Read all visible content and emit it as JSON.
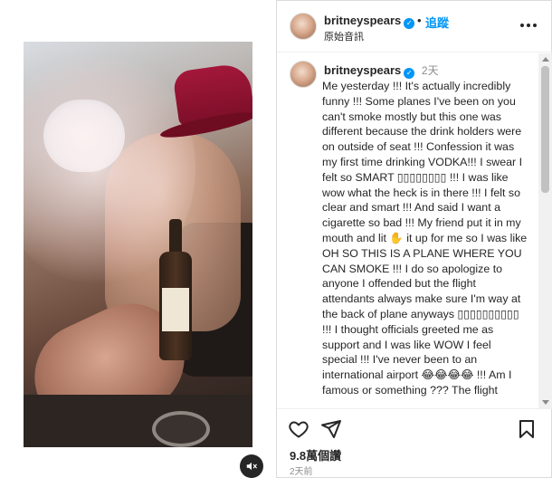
{
  "colors": {
    "accent": "#0095f6",
    "text": "#262626",
    "muted": "#8e8e8e",
    "border": "#dbdbdb"
  },
  "post": {
    "username": "britneyspears",
    "verified": true,
    "separator": "•",
    "follow_label": "追蹤",
    "audio_label": "原始音訊"
  },
  "caption": {
    "username": "britneyspears",
    "time": "2天",
    "text": "Me yesterday !!! It's actually incredibly funny !!! Some planes I've been on you can't smoke mostly but this one was different because the drink holders were on outside of seat !!! Confession it was my first time drinking VODKA!!! I swear I felt so SMART ▯▯▯▯▯▯▯▯ !!! I was like wow what the heck is in there !!! I felt so clear and smart !!! And said I want a cigarette so bad !!! My friend put it in my mouth and lit ✋ it up for me so I was like OH SO THIS IS A PLANE WHERE YOU CAN SMOKE !!! I do so apologize to anyone I offended but the flight attendants always make sure I'm way at the back of plane anyways ▯▯▯▯▯▯▯▯▯▯ !!! I thought officials greeted me as support and I was like WOW I feel special !!! I've never been to an international airport 😂😂😂😂 !!! Am I famous or something ??? The flight"
  },
  "stats": {
    "views": "9.8萬個讚",
    "posted_ago": "2天前"
  },
  "icons": {
    "like": "heart-icon",
    "share": "send-icon",
    "save": "bookmark-icon",
    "mute": "speaker-muted-icon",
    "more": "more-horizontal-icon"
  }
}
